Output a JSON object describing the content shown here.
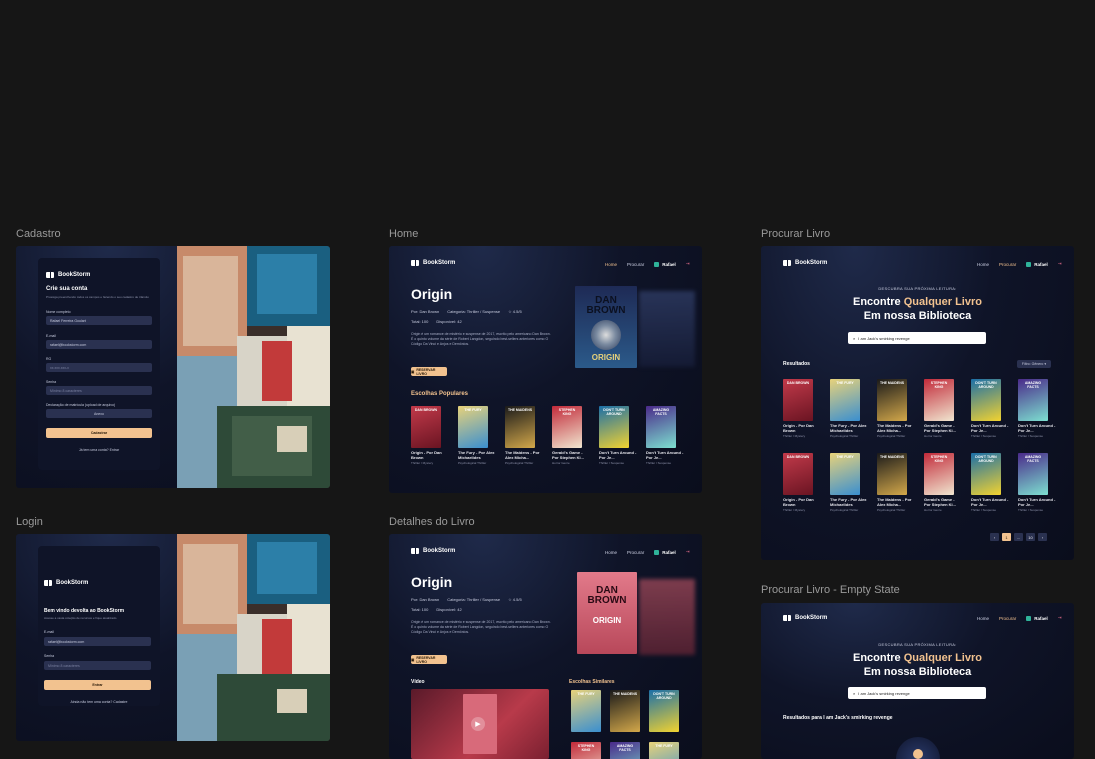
{
  "frames": {
    "cadastro": "Cadastro",
    "home": "Home",
    "procurar": "Procurar Livro",
    "login": "Login",
    "detalhes": "Detalhes do Livro",
    "empty": "Procurar Livro - Empty State"
  },
  "brand": "BookStorm",
  "nav": {
    "home": "Home",
    "procurar": "Procurar",
    "user": "Rafael"
  },
  "signup": {
    "title": "Crie sua conta",
    "subtitle": "Prossiga preenchendo todos os campos e fazendo o seu cadastro de trânsito",
    "name_label": "Nome completo",
    "name_value": "Rafael Ferreira Goulart",
    "email_label": "E-mail",
    "email_value": "rafael@bookstorm.com",
    "cpf_label": "RG",
    "cpf_placeholder": "xx.xxx.xxx-x",
    "pass_label": "Senha",
    "pass_placeholder": "Mínimo 8 caracteres",
    "file_label": "Declaração de matrícula (upload de arquivo)",
    "file_button": "Anexo",
    "submit": "Cadastrar",
    "footer": "Já tem uma conta? Entrar"
  },
  "login": {
    "title": "Bem vindo devolta ao BookStorm",
    "subtitle": "Acesse a vasta coleção de recursos e fique atualizado",
    "email_label": "E-mail",
    "email_value": "rafael@bookstorm.com",
    "pass_label": "Senha",
    "pass_placeholder": "Mínimo 8 caracteres",
    "submit": "Entrar",
    "footer": "Ainda não tem uma conta? Cadastre"
  },
  "home": {
    "title": "Origin",
    "by": "Por: Dan Brown",
    "category": "Categoria: Thriller / Suspense",
    "rating": "4.5/5",
    "total": "Total: 100",
    "available": "Disponível: 42",
    "desc": "Origin é um romance de mistério e suspense de 2017, escrito pelo americano Dan Brown. É o quinto volume da série de Robert Langdon, seguindo best-sellers anteriores como O Código Da Vinci e Anjos e Demônios.",
    "reserve": "RESERVAR LIVRO",
    "popular": "Escolhas Populares",
    "similar": "Escolhas Similares",
    "video": "Vídeo"
  },
  "books": [
    {
      "title": "Origin - Por Dan Brown",
      "genre": "Thriller / Mystery",
      "c1": "#c23a4a",
      "c2": "#6a1422",
      "txt": "DAN BROWN"
    },
    {
      "title": "The Fury - Por Alex Michaelides",
      "genre": "Psychological Thriller",
      "c1": "#e8d27a",
      "c2": "#3a8fd0",
      "txt": "THE FURY"
    },
    {
      "title": "The Maidens - Por Alex Micha...",
      "genre": "Psychological Thriller",
      "c1": "#1a1a1a",
      "c2": "#d3a84a",
      "txt": "THE MAIDENS"
    },
    {
      "title": "Gerald's Game - Por Stephen Ki...",
      "genre": "Horror Genre",
      "c1": "#c22a3a",
      "c2": "#f0e6d0",
      "txt": "STEPHEN KING"
    },
    {
      "title": "Don't Turn Around - Por Je...",
      "genre": "Thriller / Suspense",
      "c1": "#1b6fa8",
      "c2": "#f2d330",
      "txt": "DON'T TURN AROUND"
    },
    {
      "title": "Don't Turn Around - Por Je...",
      "genre": "Thriller / Suspense",
      "c1": "#4a2a8a",
      "c2": "#7de0d0",
      "txt": "AMAZING FACTS"
    }
  ],
  "search": {
    "kicker": "DESCUBRA SUA PRÓXIMA LEITURA:",
    "headline_a": "Encontre",
    "headline_b": "Qualquer Livro",
    "headline_c": "Em nossa Biblioteca",
    "query": "I am Jack's smirking revenge",
    "results": "Resultados",
    "results_for": "Resultados para I am Jack's smirking revenge",
    "filter": "Filtro: Gênero",
    "pages": [
      "1",
      "...",
      "10"
    ]
  },
  "colors": {
    "accent": "#f2c28f",
    "bg": "#161616",
    "app": "#0f1428"
  }
}
